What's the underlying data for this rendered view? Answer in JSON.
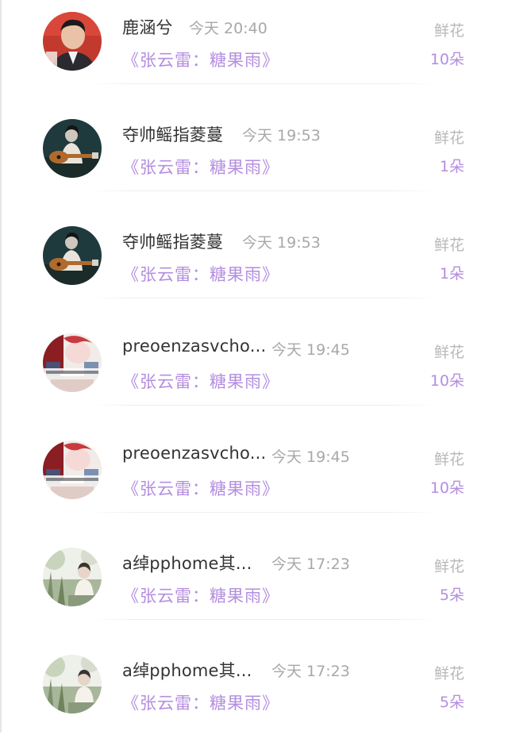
{
  "gift_list": [
    {
      "avatar": "portrait-avatar",
      "name": "鹿涵兮",
      "time": "今天 20:40",
      "song": "《张云雷：糖果雨》",
      "gift_label": "鲜花",
      "count": "10朵"
    },
    {
      "avatar": "guitar-avatar",
      "name": "夺帅鳐指菱蔓",
      "time": "今天 19:53",
      "song": "《张云雷：糖果雨》",
      "gift_label": "鲜花",
      "count": "1朵"
    },
    {
      "avatar": "guitar-avatar",
      "name": "夺帅鳐指菱蔓",
      "time": "今天 19:53",
      "song": "《张云雷：糖果雨》",
      "gift_label": "鲜花",
      "count": "1朵"
    },
    {
      "avatar": "poster-avatar",
      "name": "preoenzasvcho...",
      "time": "今天 19:45",
      "song": "《张云雷：糖果雨》",
      "gift_label": "鲜花",
      "count": "10朵"
    },
    {
      "avatar": "poster-avatar",
      "name": "preoenzasvcho...",
      "time": "今天 19:45",
      "song": "《张云雷：糖果雨》",
      "gift_label": "鲜花",
      "count": "10朵"
    },
    {
      "avatar": "garden-avatar",
      "name": "a绰pphome其...",
      "time": "今天 17:23",
      "song": "《张云雷：糖果雨》",
      "gift_label": "鲜花",
      "count": "5朵"
    },
    {
      "avatar": "garden-avatar",
      "name": "a绰pphome其...",
      "time": "今天 17:23",
      "song": "《张云雷：糖果雨》",
      "gift_label": "鲜花",
      "count": "5朵"
    }
  ],
  "colors": {
    "accent": "#b48ee0",
    "name_text": "#333333",
    "muted_text": "#a8a8a8"
  }
}
